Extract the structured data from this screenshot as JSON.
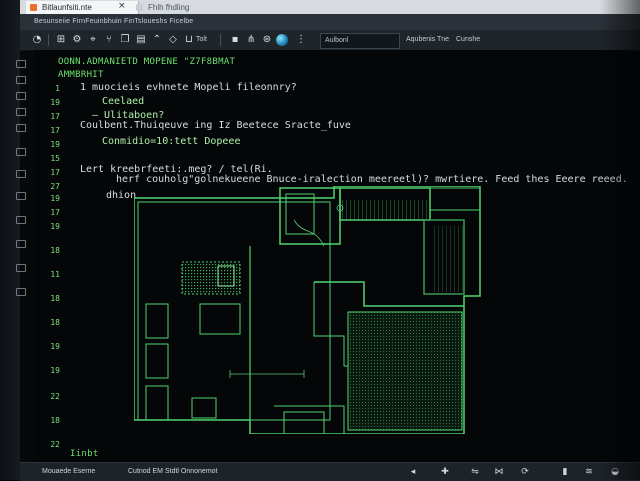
{
  "tabs": [
    {
      "label": "Bitlaunfsiti.nte",
      "active": true
    },
    {
      "label": "Fhlh fhdling",
      "active": false
    }
  ],
  "tab_close_icon": "×",
  "menu": {
    "text": "Besunseiie FirnFeuinbhuin  FinTsloueshs Ficelbe"
  },
  "toolbar": {
    "field_text": "Aulbonl",
    "text_a": "Aqubenis Tne",
    "text_b": "Cunshe",
    "icon_label_a": "Tolt"
  },
  "editor": {
    "header_lines": [
      "OONN.ADMANIETD MOPENE \"Z7F8BMAT",
      "AMMBRHIT"
    ],
    "lines": [
      {
        "no": "1",
        "text": "1 muocieis  evhnete  Mopeli fileonnry?"
      },
      {
        "no": "19",
        "text": "Ceelaed"
      },
      {
        "no": "17",
        "text": "– Ulitaboen?"
      },
      {
        "no": "17",
        "text": "Coulbent.Thuiqeuve ing  Iz  Beetece  Sracte_fuve"
      },
      {
        "no": "19",
        "text": "Conmidio=10:tett Dopeee"
      },
      {
        "no": "17",
        "text": "Lert kreebrfeeti:.meg? / tel(Ri."
      },
      {
        "no": "27",
        "text": "herf couholg\"golnekueene Bnuce-iralection meereetl)?  mwrtiere. Feed  thes Eeere reeed."
      },
      {
        "no": "19",
        "text": "dhion"
      }
    ],
    "more_line_numbers": [
      "15",
      "17",
      "19",
      "18",
      "11",
      "18",
      "18",
      "19",
      "19",
      "22",
      "18",
      "21"
    ],
    "footer_line": {
      "no": "22",
      "text": "Iinbt"
    }
  },
  "status": {
    "left": "Mouaede Eserne",
    "center": "Cutnod EM Stdtl Onnonemot"
  },
  "colors": {
    "code_green": "#6de26d",
    "plan_green": "#4fd36f",
    "editor_bg": "#040608"
  },
  "icons": {
    "toolbar": [
      "back-icon",
      "terminal-icon",
      "settings-icon",
      "map-icon",
      "git-icon",
      "copy-icon",
      "document-icon",
      "cursor-icon",
      "run-icon",
      "folder-icon",
      "save-icon",
      "filter-icon",
      "git-branch-icon"
    ],
    "status": [
      "plus-icon",
      "network-icon",
      "notification-icon",
      "speaker-icon",
      "battery-icon"
    ]
  }
}
